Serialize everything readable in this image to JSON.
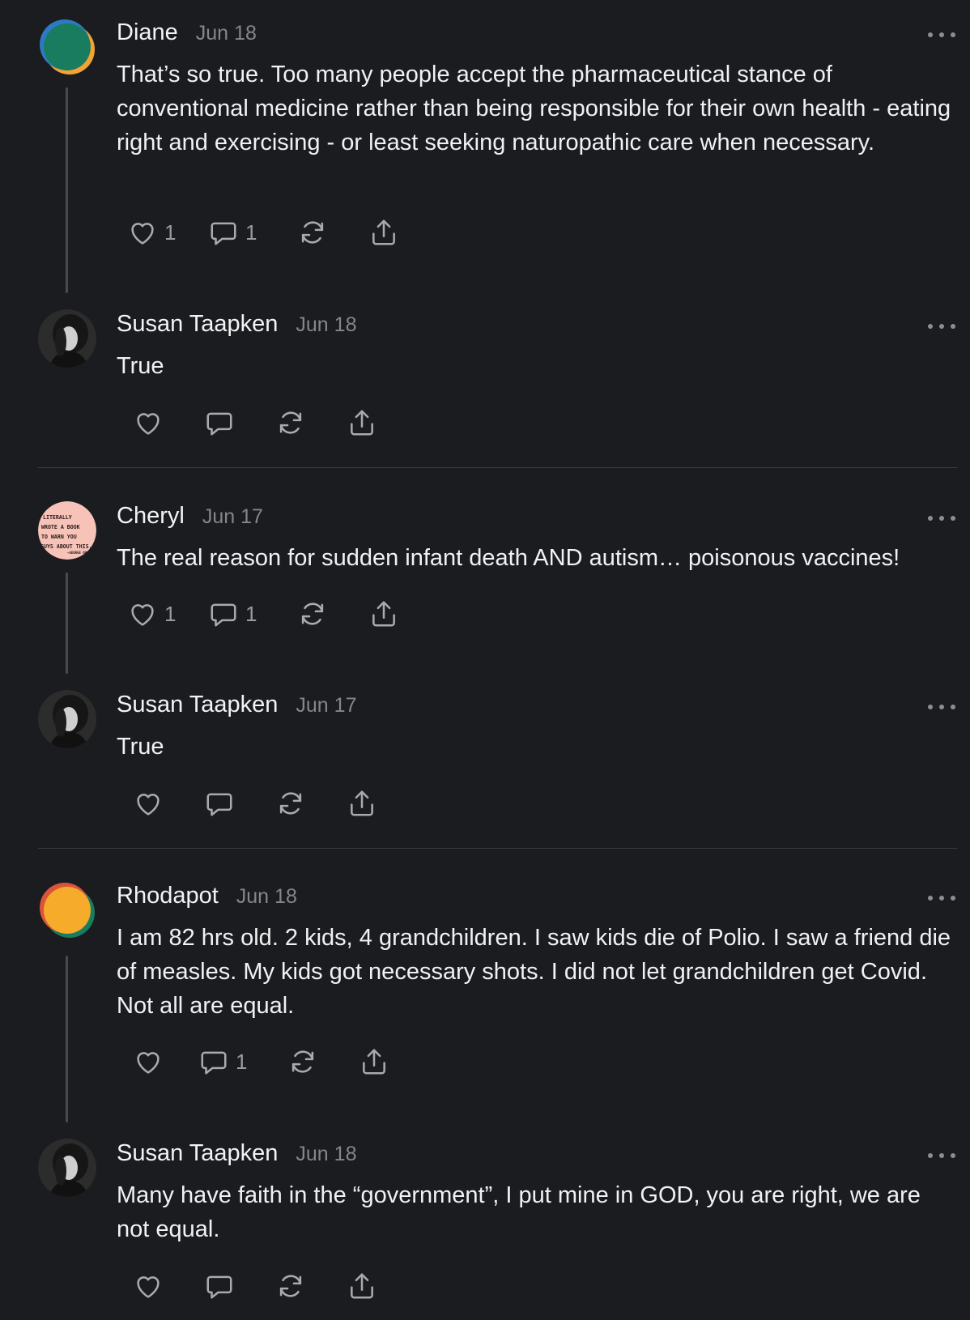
{
  "comments": [
    {
      "author": "Diane",
      "date": "Jun 18",
      "text": "That’s so true. Too many people accept the pharmaceutical stance of conventional medicine rather than being responsible for their own health - eating right and exercising - or least seeking naturopathic care when necessary.",
      "like_count": "1",
      "reply_count": "1",
      "avatar": "diane-avatar"
    },
    {
      "author": "Susan Taapken",
      "date": "Jun 18",
      "text": "True",
      "avatar": "susan-avatar"
    },
    {
      "author": "Cheryl",
      "date": "Jun 17",
      "text": "The real reason for sudden infant death AND autism… poisonous vaccines!",
      "like_count": "1",
      "reply_count": "1",
      "avatar": "cheryl-avatar",
      "avatar_text": [
        "LITERALLY",
        "WROTE A BOOK",
        "TO WARN YOU",
        "GUYS ABOUT THIS.",
        "—GEORGE ORW"
      ]
    },
    {
      "author": "Susan Taapken",
      "date": "Jun 17",
      "text": "True",
      "avatar": "susan-avatar"
    },
    {
      "author": "Rhodapot",
      "date": "Jun 18",
      "text": "I am 82 hrs old. 2 kids, 4 grandchildren. I saw kids die of Polio. I saw a friend die of measles. My kids got necessary shots. I did not let grandchildren get Covid. Not all are equal.",
      "reply_count": "1",
      "avatar": "rhodapot-avatar"
    },
    {
      "author": "Susan Taapken",
      "date": "Jun 18",
      "text": "Many have faith in the “government”, I put mine in GOD, you are right, we are not equal.",
      "avatar": "susan-avatar"
    }
  ],
  "icons": {
    "like": "heart-icon",
    "reply": "comment-bubble-icon",
    "restack": "restack-icon",
    "share": "share-icon",
    "more": "more-options-icon"
  },
  "colors": {
    "background": "#1b1c1f",
    "text": "#f2f2f3",
    "muted": "#85868c",
    "icon": "#a9aaaf"
  }
}
